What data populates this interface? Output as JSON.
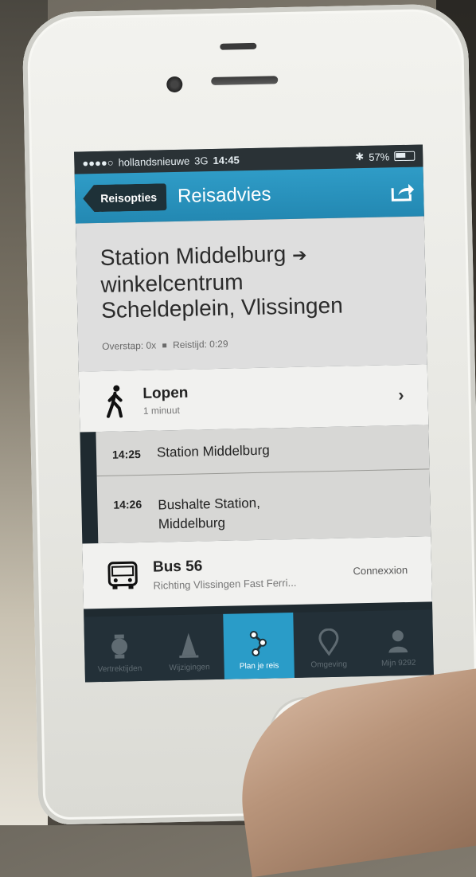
{
  "status_bar": {
    "signal_dots": "●●●●○",
    "carrier": "hollandsnieuwe",
    "network": "3G",
    "time": "14:45",
    "battery_percent": "57%"
  },
  "nav": {
    "back_label": "Reisopties",
    "title": "Reisadvies",
    "share_icon": "share-icon"
  },
  "route": {
    "title_line1": "Station Middelburg",
    "arrow": "➔",
    "title_line2": "winkelcentrum",
    "title_line3": "Scheldeplein, Vlissingen",
    "transfers": "Overstap: 0x",
    "travel_time": "Reistijd: 0:29"
  },
  "walk": {
    "label": "Lopen",
    "duration": "1 minuut",
    "chevron": "›"
  },
  "stops": [
    {
      "time": "14:25",
      "name": "Station Middelburg"
    },
    {
      "time": "14:26",
      "name_line1": "Bushalte Station,",
      "name_line2": "Middelburg"
    }
  ],
  "bus": {
    "label": "Bus 56",
    "direction": "Richting Vlissingen Fast Ferri...",
    "operator": "Connexxion"
  },
  "tabs": [
    {
      "label": "Vertrektijden",
      "icon": "clock-icon"
    },
    {
      "label": "Wijzigingen",
      "icon": "traffic-cone-icon"
    },
    {
      "label": "Plan je reis",
      "icon": "route-icon",
      "active": true
    },
    {
      "label": "Omgeving",
      "icon": "location-pin-icon"
    },
    {
      "label": "Mijn 9292",
      "icon": "person-icon"
    }
  ],
  "colors": {
    "accent_blue": "#2a9cc8",
    "tabbar_dark": "#233038",
    "header_grey": "#dedede"
  }
}
